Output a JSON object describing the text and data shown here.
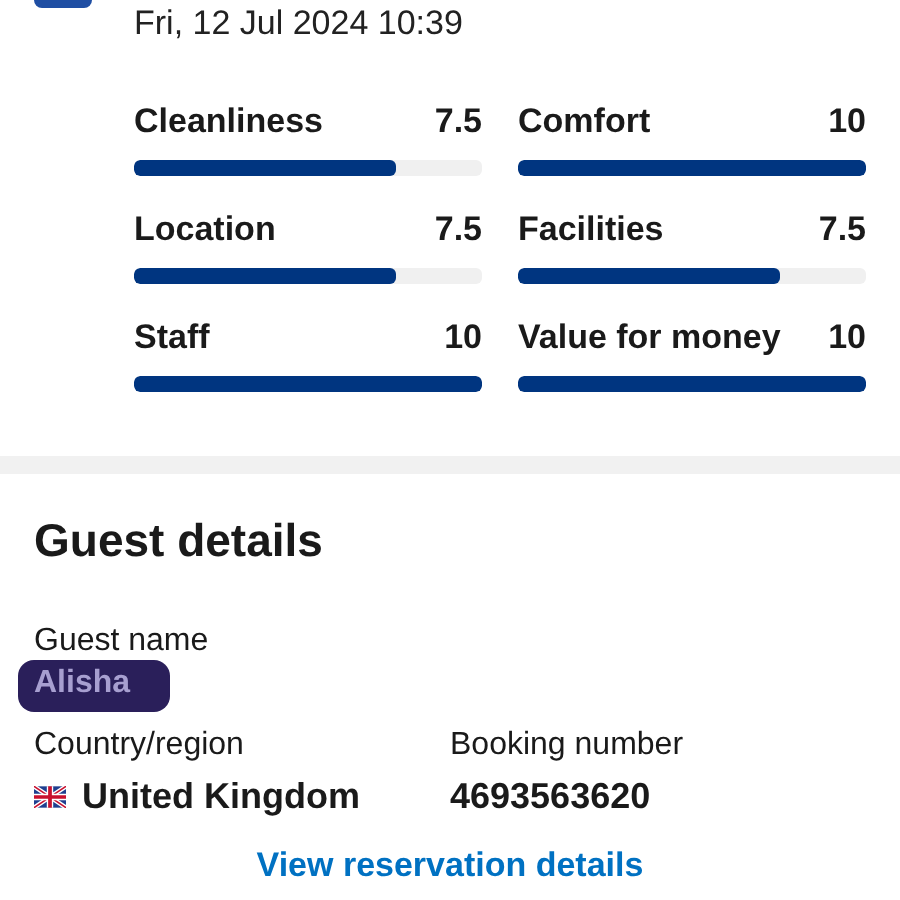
{
  "review": {
    "date": "Fri, 12 Jul 2024 10:39",
    "scores": [
      {
        "label": "Cleanliness",
        "score": "7.5",
        "level": 0.75
      },
      {
        "label": "Comfort",
        "score": "10",
        "level": 1
      },
      {
        "label": "Location",
        "score": "7.5",
        "level": 0.75
      },
      {
        "label": "Facilities",
        "score": "7.5",
        "level": 0.75
      },
      {
        "label": "Staff",
        "score": "10",
        "level": 1
      },
      {
        "label": "Value for money",
        "score": "10",
        "level": 1
      }
    ]
  },
  "guest_details": {
    "title": "Guest details",
    "guest_name": {
      "label": "Guest name",
      "value": "Alisha",
      "redacted": true
    },
    "country": {
      "label": "Country/region",
      "value": "United Kingdom"
    },
    "booking": {
      "label": "Booking number",
      "value": "4693563620"
    },
    "link": "View reservation details"
  }
}
